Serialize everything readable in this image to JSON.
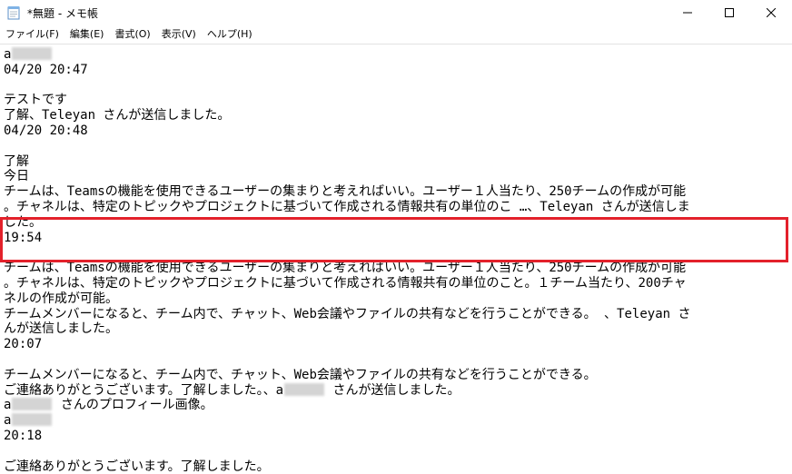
{
  "window": {
    "title": "*無題 - メモ帳",
    "minimize_glyph": "—",
    "maximize_glyph": "☐",
    "close_glyph": "✕"
  },
  "menu": [
    "ファイル(F)",
    "編集(E)",
    "書式(O)",
    "表示(V)",
    "ヘルプ(H)"
  ],
  "editor": {
    "lines": [
      "a",
      "04/20 20:47",
      "",
      "テストです",
      "了解、Teleyan さんが送信しました。",
      "04/20 20:48",
      "",
      "了解",
      "今日",
      "チームは、Teamsの機能を使用できるユーザーの集まりと考えればいい。ユーザー１人当たり、250チームの作成が可能",
      "。チャネルは、特定のトピックやプロジェクトに基づいて作成される情報共有の単位のこ …、Teleyan さんが送信しま",
      "した。",
      "19:54",
      "",
      "チームは、Teamsの機能を使用できるユーザーの集まりと考えればいい。ユーザー１人当たり、250チームの作成が可能",
      "。チャネルは、特定のトピックやプロジェクトに基づいて作成される情報共有の単位のこと。１チーム当たり、200チャ",
      "ネルの作成が可能。",
      "チームメンバーになると、チーム内で、チャット、Web会議やファイルの共有などを行うことができる。 、Teleyan さ",
      "んが送信しました。",
      "20:07",
      "",
      "チームメンバーになると、チーム内で、チャット、Web会議やファイルの共有などを行うことができる。",
      "ご連絡ありがとうございます。了解しました。、a{R} さんが送信しました。",
      "a{R} さんのプロフィール画像。",
      "a",
      "20:18",
      "",
      "ご連絡ありがとうございます。了解しました。"
    ],
    "redacted_lines": [
      0,
      22,
      23,
      24
    ]
  },
  "highlight": {
    "color": "#e3212b"
  }
}
